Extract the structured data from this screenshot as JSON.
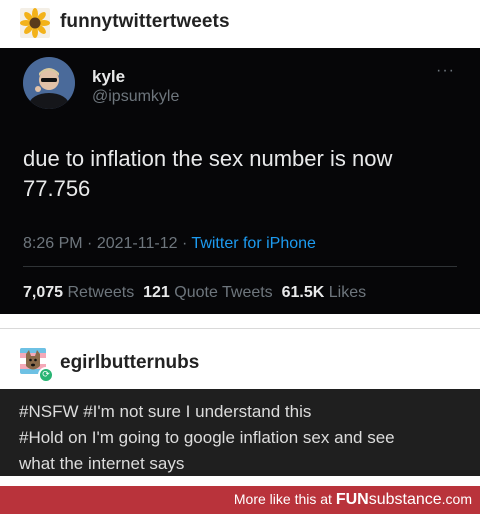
{
  "post1": {
    "username": "funnytwittertweets"
  },
  "tweet": {
    "name": "kyle",
    "handle": "@ipsumkyle",
    "more": "···",
    "text": "due to inflation the sex number is now 77.756",
    "time": "8:26 PM",
    "date": "2021-11-12",
    "separator": "·",
    "source": "Twitter for iPhone",
    "retweets_count": "7,075",
    "retweets_label": "Retweets",
    "quotes_count": "121",
    "quotes_label": "Quote Tweets",
    "likes_count": "61.5K",
    "likes_label": "Likes"
  },
  "post2": {
    "username": "egirlbutternubs",
    "tags_line1": "#NSFW #I'm not sure I understand this",
    "tags_line2": "#Hold on I'm going to google inflation sex and see",
    "tags_line3": "what the internet says"
  },
  "footer": {
    "prefix": "More like this at ",
    "brand_bold": "FUN",
    "brand_rest": "substance",
    "domain": ".com"
  },
  "colors": {
    "tweet_bg": "#060608",
    "twitter_blue": "#1d9bf0",
    "tags_bg": "#1f1f1f",
    "footer_bg": "#b9333b"
  },
  "icons": [
    "sunflower-avatar-icon",
    "kyle-avatar-icon",
    "more-options-icon",
    "dog-avatar-icon",
    "reblog-icon"
  ]
}
